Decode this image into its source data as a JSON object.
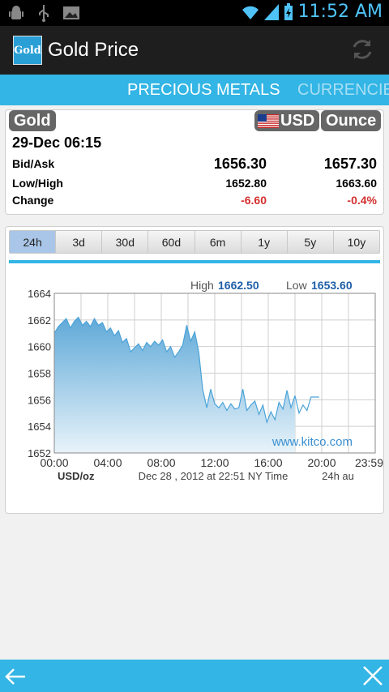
{
  "status_bar": {
    "time": "11:52 AM"
  },
  "app": {
    "title": "Gold Price",
    "icon_text": "Gold"
  },
  "tabs": [
    {
      "label": "PRECIOUS METALS"
    },
    {
      "label": "CURRENCIES"
    }
  ],
  "quote": {
    "metal": "Gold",
    "currency": "USD",
    "unit": "Ounce",
    "datetime": "29-Dec 06:15",
    "bid_ask_label": "Bid/Ask",
    "bid": "1656.30",
    "ask": "1657.30",
    "low_high_label": "Low/High",
    "low": "1652.80",
    "high": "1663.60",
    "change_label": "Change",
    "change": "-6.60",
    "change_pct": "-0.4%"
  },
  "ranges": [
    "24h",
    "3d",
    "30d",
    "60d",
    "6m",
    "1y",
    "5y",
    "10y"
  ],
  "selected_range": "24h",
  "colors": {
    "accent": "#33b5e5",
    "negative": "#d32f2f",
    "line": "#4aa3d8"
  },
  "chart_data": {
    "type": "area",
    "high_label": "High",
    "high_value": "1662.50",
    "low_label": "Low",
    "low_value": "1653.60",
    "ylim": [
      1652,
      1664
    ],
    "yticks": [
      1664,
      1662,
      1660,
      1658,
      1656,
      1654,
      1652
    ],
    "xlim": [
      0,
      24
    ],
    "xticks": [
      {
        "x": 0,
        "label": "00:00"
      },
      {
        "x": 4,
        "label": "04:00"
      },
      {
        "x": 8,
        "label": "08:00"
      },
      {
        "x": 12,
        "label": "12:00"
      },
      {
        "x": 16,
        "label": "16:00"
      },
      {
        "x": 20,
        "label": "20:00"
      },
      {
        "x": 23.98,
        "label": "23:59"
      }
    ],
    "unit_label": "USD/oz",
    "timestamp": "Dec 28 , 2012 at 22:51 NY Time",
    "period_label": "24h au",
    "watermark": "www.kitco.com",
    "series": [
      {
        "x": [
          0,
          0.3,
          0.6,
          0.9,
          1.2,
          1.5,
          1.8,
          2.1,
          2.4,
          2.7,
          3.0,
          3.3,
          3.6,
          3.9,
          4.2,
          4.5,
          4.8,
          5.1,
          5.4,
          5.7,
          6.0,
          6.3,
          6.6,
          6.9,
          7.2,
          7.5,
          7.8,
          8.1,
          8.4,
          8.7,
          9.0,
          9.3,
          9.6,
          9.9,
          10.2,
          10.5,
          10.8,
          11.1,
          11.4,
          11.7,
          12.0,
          12.3,
          12.6,
          12.9,
          13.2,
          13.5,
          13.8,
          14.1,
          14.4,
          14.7,
          15.0,
          15.3,
          15.6,
          15.9,
          16.2,
          16.5,
          16.8,
          17.1,
          17.4,
          17.7,
          18.0
        ],
        "y": [
          1661.0,
          1661.5,
          1661.8,
          1662.1,
          1661.4,
          1661.9,
          1662.2,
          1661.6,
          1661.9,
          1661.5,
          1662.1,
          1661.6,
          1661.8,
          1661.1,
          1661.4,
          1660.8,
          1661.2,
          1660.3,
          1660.6,
          1659.6,
          1659.9,
          1660.2,
          1659.7,
          1660.3,
          1660.0,
          1660.4,
          1660.1,
          1660.5,
          1659.6,
          1660.0,
          1659.2,
          1659.6,
          1660.1,
          1661.6,
          1660.4,
          1661.1,
          1659.6,
          1656.8,
          1655.4,
          1656.8,
          1655.7,
          1655.4,
          1655.8,
          1655.2,
          1655.7,
          1655.3,
          1655.4,
          1656.8,
          1655.2,
          1655.6,
          1655.9,
          1654.9,
          1655.6,
          1654.3,
          1655.1,
          1654.5,
          1655.8,
          1655.3,
          1656.7,
          1655.4,
          1656.3
        ]
      }
    ],
    "tail": {
      "x": [
        18.0,
        18.3,
        18.6,
        18.9,
        19.2,
        19.5,
        19.8
      ],
      "y": [
        1656.3,
        1655.0,
        1655.6,
        1655.2,
        1656.2,
        1656.2,
        1656.2
      ]
    }
  }
}
